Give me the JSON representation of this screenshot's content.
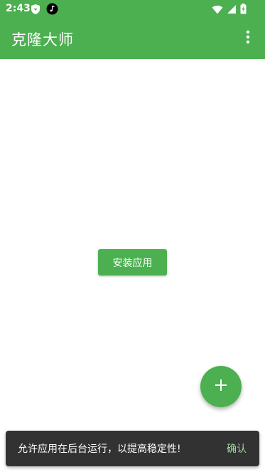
{
  "status_bar": {
    "time": "2:43",
    "left_icons": [
      "shield-icon",
      "music-note-icon"
    ],
    "right_icons": [
      "wifi-icon",
      "signal-icon",
      "battery-charging-icon"
    ]
  },
  "app_bar": {
    "title": "克隆大师",
    "overflow_icon": "more-vert-icon"
  },
  "main": {
    "install_button_label": "安装应用"
  },
  "fab": {
    "icon": "plus-icon"
  },
  "snackbar": {
    "message": "允许应用在后台运行，以提高稳定性!",
    "action_label": "确认"
  },
  "colors": {
    "primary": "#4caf50",
    "snackbar_bg": "#323232",
    "snackbar_action": "#a5d6a7"
  }
}
